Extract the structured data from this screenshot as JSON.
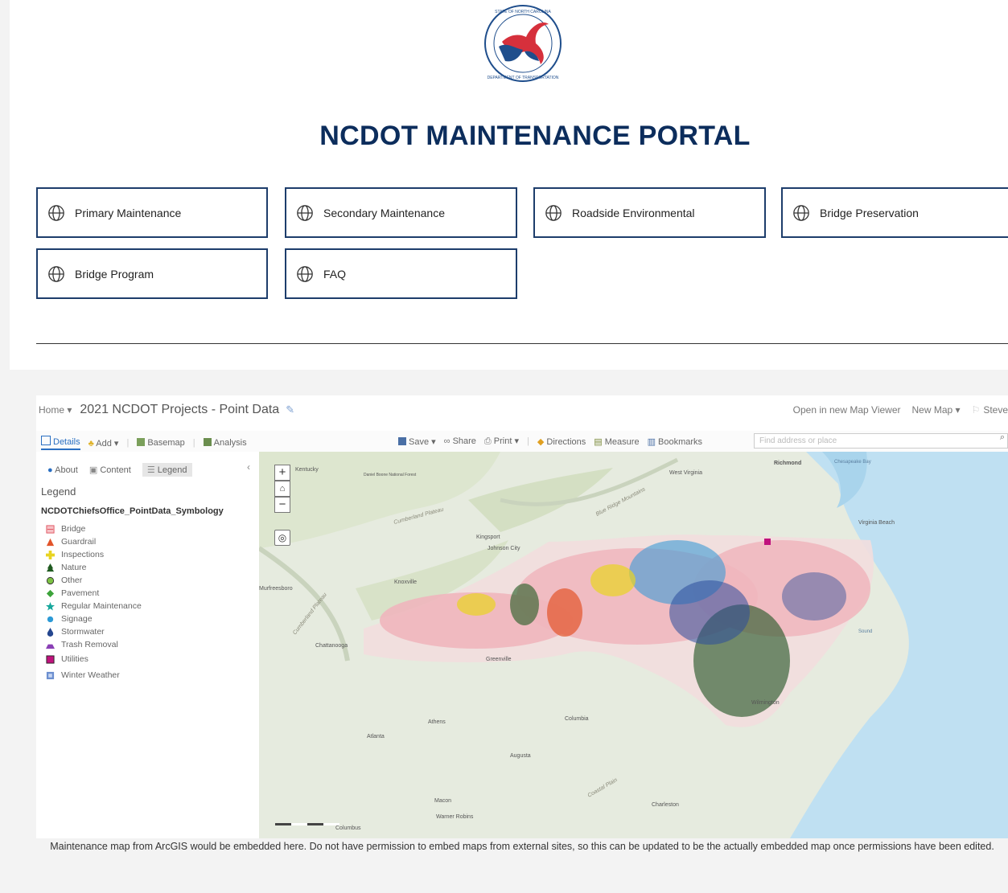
{
  "site": {
    "title": "NCDOT MAINTENANCE PORTAL",
    "logo_icon": "ncdot-seal-icon",
    "logo_text": "STATE OF NORTH CAROLINA · DEPARTMENT OF TRANSPORTATION",
    "brand_color": "#0c2d5c",
    "logo_red": "#d6303c",
    "logo_blue": "#1f4e8c"
  },
  "nav_tiles": [
    {
      "label": "Primary Maintenance",
      "icon": "globe-icon"
    },
    {
      "label": "Secondary Maintenance",
      "icon": "globe-icon"
    },
    {
      "label": "Roadside Environmental",
      "icon": "globe-icon"
    },
    {
      "label": "Bridge Preservation",
      "icon": "globe-icon"
    },
    {
      "label": "Bridge Program",
      "icon": "globe-icon"
    },
    {
      "label": "FAQ",
      "icon": "globe-icon"
    }
  ],
  "map_viewer": {
    "home": "Home ▾",
    "title": "2021 NCDOT Projects - Point Data",
    "header_right": [
      "Open in new Map Viewer",
      "New Map ▾",
      "Steve"
    ],
    "toolbar_left": [
      "Details",
      "Add ▾",
      "Basemap",
      "Analysis"
    ],
    "toolbar_center": [
      "Save ▾",
      "Share",
      "Print ▾",
      "Directions",
      "Measure",
      "Bookmarks"
    ],
    "search_placeholder": "Find address or place",
    "panel_tabs": [
      "About",
      "Content",
      "Legend"
    ],
    "legend_heading": "Legend",
    "layer_name": "NCDOTChiefsOffice_PointData_Symbology",
    "legend_items": [
      {
        "label": "Bridge",
        "symbol": "bridge-icon",
        "color": "#e0525e"
      },
      {
        "label": "Guardrail",
        "symbol": "triangle-icon",
        "color": "#e2542a"
      },
      {
        "label": "Inspections",
        "symbol": "cross-icon",
        "color": "#e8d422"
      },
      {
        "label": "Nature",
        "symbol": "tree-icon",
        "color": "#1f5a20"
      },
      {
        "label": "Other",
        "symbol": "circle-icon",
        "color": "#7cc243"
      },
      {
        "label": "Pavement",
        "symbol": "diamond-icon",
        "color": "#3da33b"
      },
      {
        "label": "Regular Maintenance",
        "symbol": "star-icon",
        "color": "#17a79c"
      },
      {
        "label": "Signage",
        "symbol": "dot-icon",
        "color": "#2c9ad6"
      },
      {
        "label": "Stormwater",
        "symbol": "drop-icon",
        "color": "#25478f"
      },
      {
        "label": "Trash Removal",
        "symbol": "mound-icon",
        "color": "#8a3fb5"
      },
      {
        "label": "Utilities",
        "symbol": "square-icon",
        "color": "#c0127d"
      },
      {
        "label": "Winter Weather",
        "symbol": "square-outline-icon",
        "color": "#6c8fd0"
      }
    ],
    "map_labels": [
      "Kentucky",
      "Daniel Boone National Forest",
      "Cumberland Plateau",
      "Blue Ridge Mountains",
      "West Virginia",
      "Richmond",
      "Chesapeake Bay",
      "Virginia Beach",
      "Kingsport",
      "Johnson City",
      "Knoxville",
      "Murfreesboro",
      "Cumberland Plateau",
      "Chattanooga",
      "Greenville",
      "Sound",
      "Wilmington",
      "Columbia",
      "Athens",
      "Atlanta",
      "Augusta",
      "Coastal Plain",
      "Macon",
      "Warner Robins",
      "Charleston",
      "Columbus"
    ],
    "zoom_in": "+",
    "zoom_out": "−"
  },
  "caption": "Maintenance map from ArcGIS would be embedded here. Do not have permission to embed maps from external sites, so this can be updated to be the actually embedded map once permissions have been edited."
}
